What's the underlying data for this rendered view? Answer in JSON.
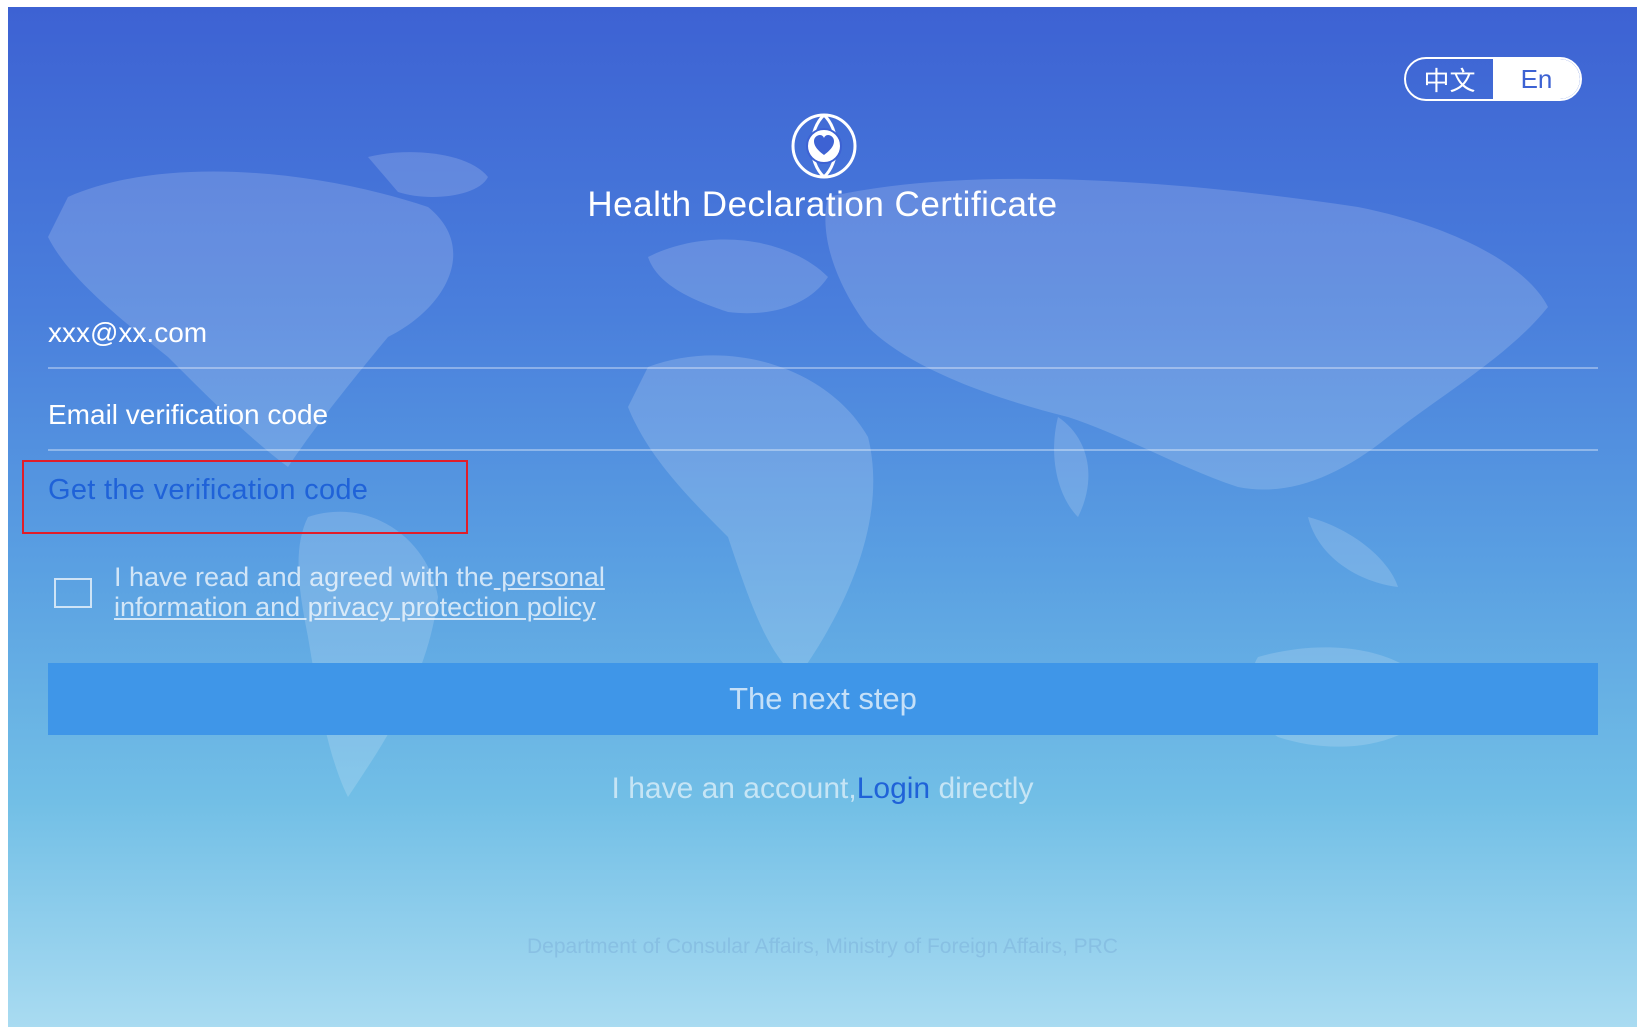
{
  "lang_toggle": {
    "zh_label": "中文",
    "en_label": "En",
    "selected": "En"
  },
  "header": {
    "logo_icon": "globe-heart-icon",
    "title": "Health Declaration Certificate"
  },
  "form": {
    "email_value": "xxx@xx.com",
    "code_placeholder": "Email verification code",
    "get_code_label": "Get the verification code",
    "agree_prefix": "I have read and agreed with the",
    "agree_link": " personal information and privacy protection policy",
    "agree_checked": false,
    "next_label": "The next step"
  },
  "login_prompt": {
    "prefix": "I have an account,",
    "link": "Login",
    "suffix": " directly"
  },
  "footer": {
    "text": "Department of Consular Affairs, Ministry of Foreign Affairs, PRC"
  },
  "colors": {
    "accent": "#1f62d8",
    "button": "#3f96e8",
    "highlight": "#e11d2a"
  }
}
